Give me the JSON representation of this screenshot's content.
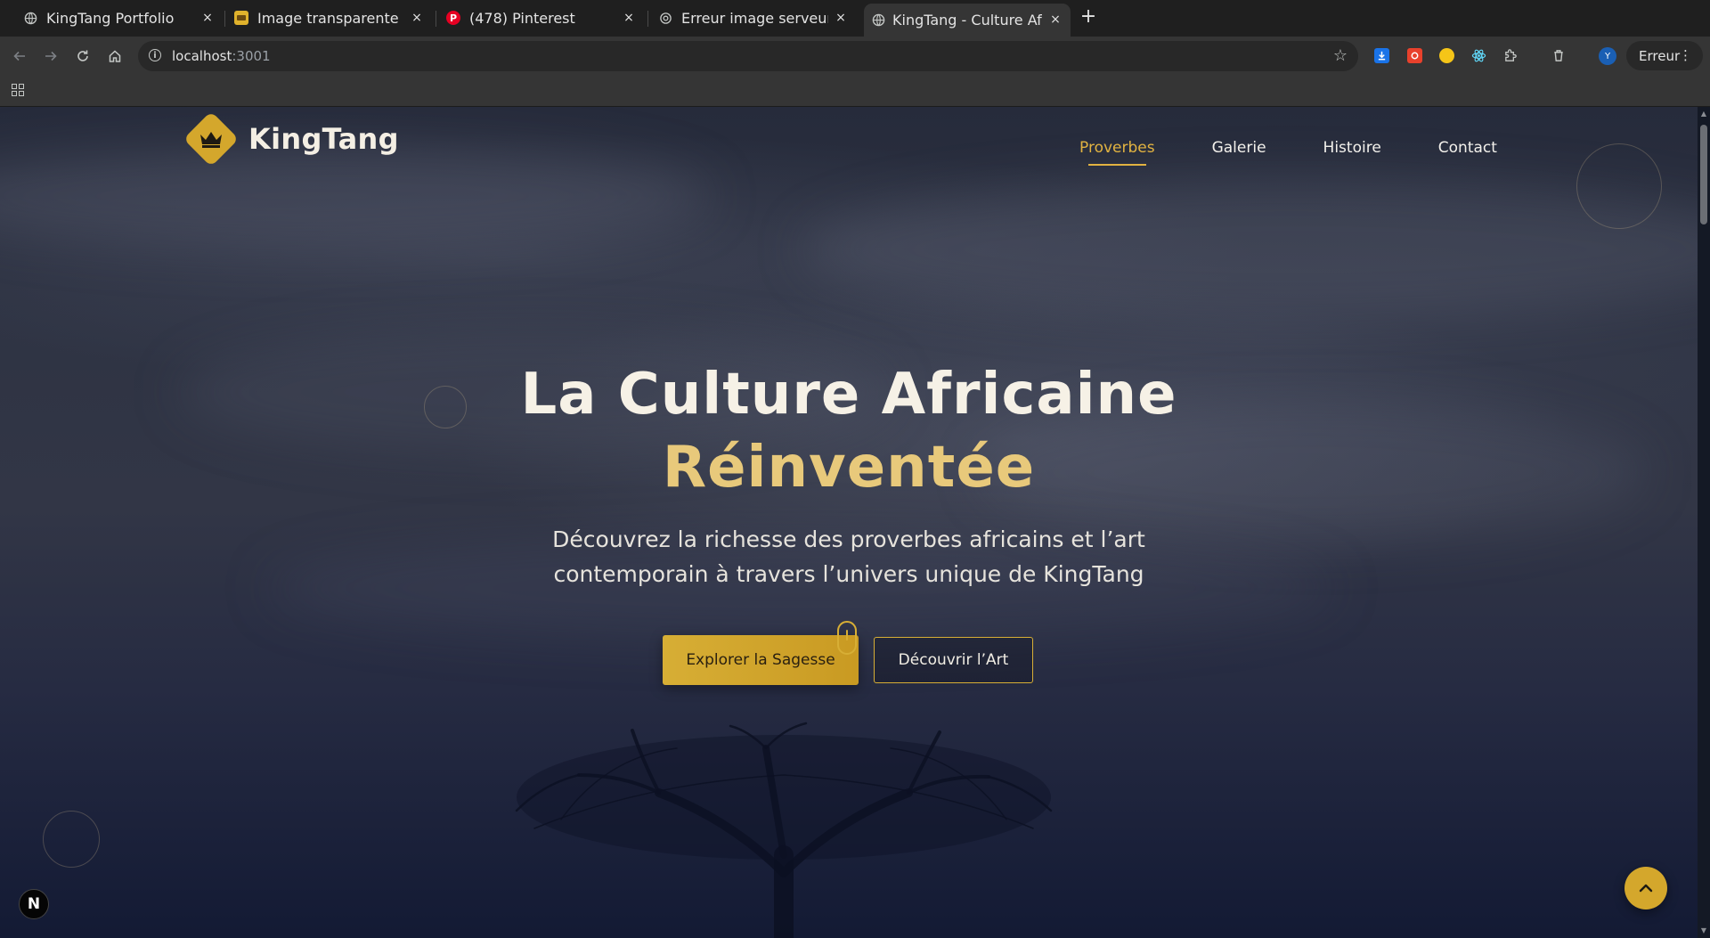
{
  "browser": {
    "tabs": [
      {
        "title": "KingTang Portfolio",
        "icon": "globe-icon",
        "active": false
      },
      {
        "title": "Image transparente : I",
        "icon": "site-favicon-icon",
        "active": false
      },
      {
        "title": "(478) Pinterest",
        "icon": "pinterest-icon",
        "active": false
      },
      {
        "title": "Erreur image serveur",
        "icon": "openai-icon",
        "active": false
      },
      {
        "title": "KingTang - Culture Afri",
        "icon": "globe-icon",
        "active": true
      }
    ],
    "new_tab_label": "+",
    "url_host": "localhost",
    "url_port": ":3001",
    "profile_initial": "Y",
    "error_button_label": "Erreur",
    "close_glyph": "×"
  },
  "site": {
    "brand": "KingTang",
    "nav": [
      {
        "label": "Proverbes",
        "active": true
      },
      {
        "label": "Galerie",
        "active": false
      },
      {
        "label": "Histoire",
        "active": false
      },
      {
        "label": "Contact",
        "active": false
      }
    ],
    "accent_color": "#d4a72c"
  },
  "hero": {
    "title": "La Culture Africaine",
    "title_accent": "Réinventée",
    "subtitle": "Découvrez la richesse des proverbes africains et l’art contemporain à travers l’univers unique de KingTang",
    "primary_cta": "Explorer la Sagesse",
    "secondary_cta": "Découvrir l’Art"
  },
  "overlay": {
    "dev_badge": "N"
  }
}
